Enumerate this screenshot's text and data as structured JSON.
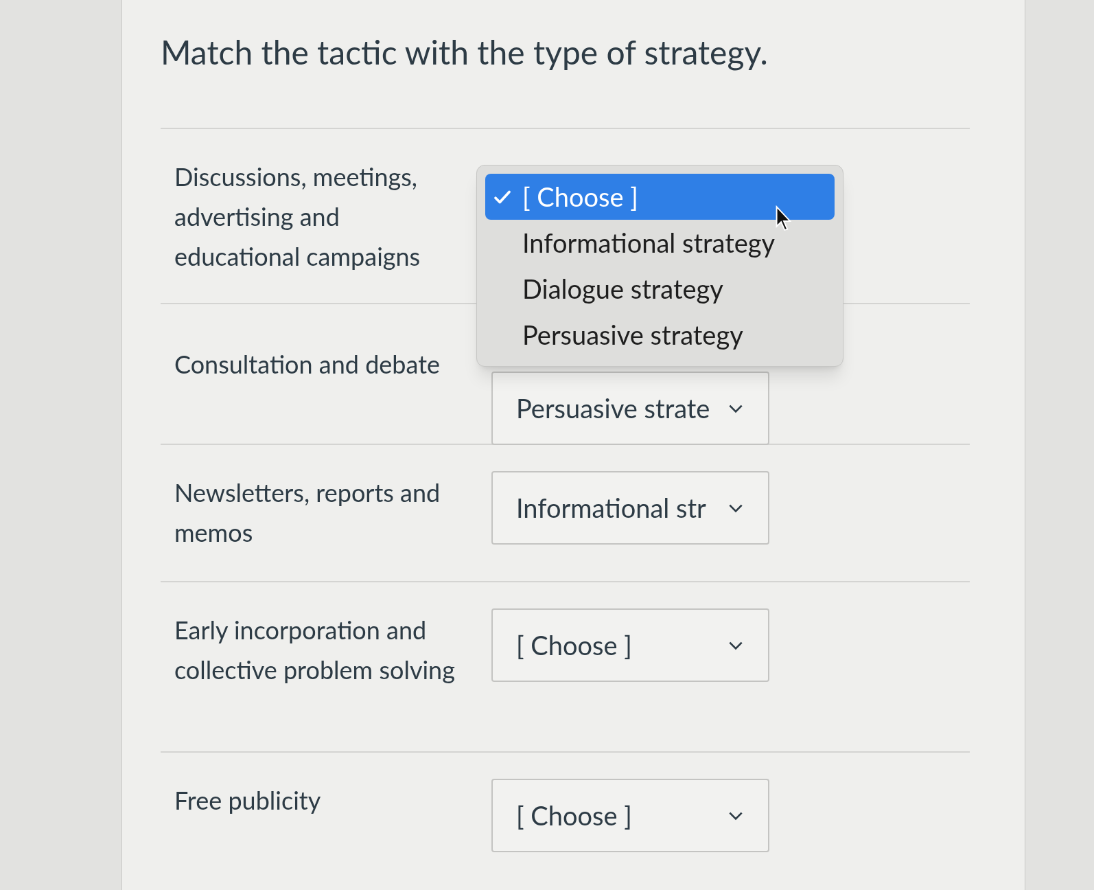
{
  "question": "Match the tactic with the type of strategy.",
  "rows": [
    {
      "tactic": "Discussions, meetings, advertising and educational campaigns",
      "dropdown": {
        "expanded": true,
        "options": [
          {
            "label": "[ Choose ]",
            "selected": true
          },
          {
            "label": "Informational strategy",
            "selected": false
          },
          {
            "label": "Dialogue strategy",
            "selected": false
          },
          {
            "label": "Persuasive strategy",
            "selected": false
          }
        ]
      }
    },
    {
      "tactic": "Consultation and debate",
      "dropdown": {
        "expanded": false,
        "value": "Persuasive strate"
      }
    },
    {
      "tactic": "Newsletters, reports and memos",
      "dropdown": {
        "expanded": false,
        "value": "Informational str"
      }
    },
    {
      "tactic": "Early incorporation and collective problem solving",
      "dropdown": {
        "expanded": false,
        "value": "[ Choose ]"
      }
    },
    {
      "tactic": "Free publicity",
      "dropdown": {
        "expanded": false,
        "value": "[ Choose ]"
      }
    }
  ]
}
